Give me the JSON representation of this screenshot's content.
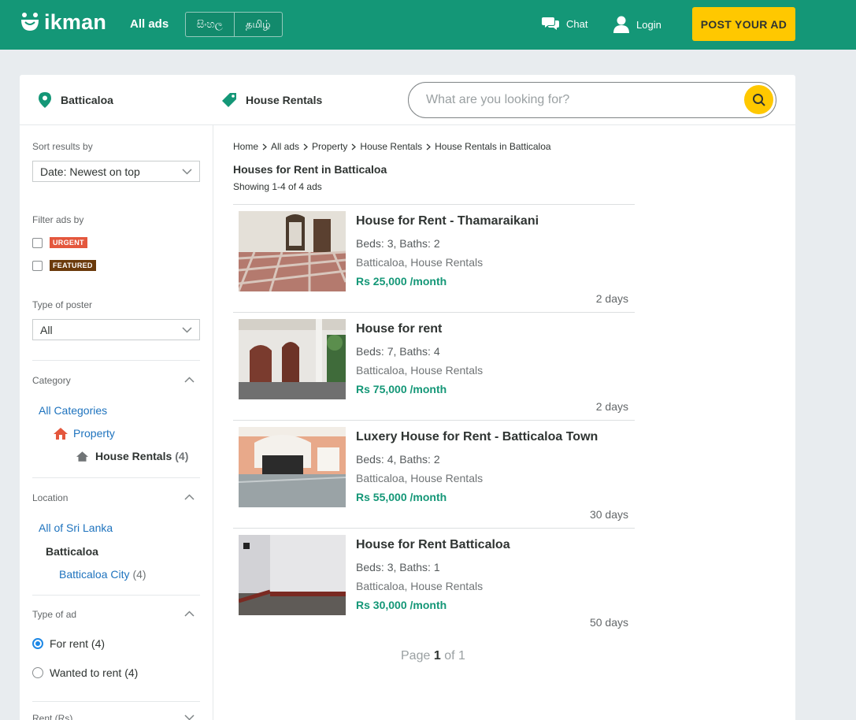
{
  "header": {
    "logo_text": "ikman",
    "all_ads": "All ads",
    "lang_sinhala": "සිංහල",
    "lang_tamil": "தமிழ்",
    "chat": "Chat",
    "login": "Login",
    "post_ad": "POST YOUR AD"
  },
  "filterbar": {
    "location": "Batticaloa",
    "category": "House Rentals",
    "search_placeholder": "What are you looking for?"
  },
  "sidebar": {
    "sort_label": "Sort results by",
    "sort_value": "Date: Newest on top",
    "filter_label": "Filter ads by",
    "urgent": "URGENT",
    "featured": "FEATURED",
    "poster_label": "Type of poster",
    "poster_value": "All",
    "category_label": "Category",
    "all_categories": "All Categories",
    "property": "Property",
    "house_rentals": "House Rentals",
    "house_rentals_count": "(4)",
    "location_label": "Location",
    "all_sri_lanka": "All of Sri Lanka",
    "batticaloa": "Batticaloa",
    "batticaloa_city": "Batticaloa City",
    "batticaloa_city_count": "(4)",
    "type_ad_label": "Type of ad",
    "for_rent": "For rent (4)",
    "wanted_to_rent": "Wanted to rent (4)",
    "rent_label": "Rent (Rs)"
  },
  "breadcrumbs": [
    "Home",
    "All ads",
    "Property",
    "House Rentals",
    "House Rentals in Batticaloa"
  ],
  "results": {
    "title": "Houses for Rent in Batticaloa",
    "showing": "Showing 1-4 of 4 ads"
  },
  "listings": [
    {
      "title": "House for Rent - Thamaraikani",
      "attrs": "Beds: 3, Baths: 2",
      "location": "Batticaloa, House Rentals",
      "price": "Rs 25,000 /month",
      "time": "2 days"
    },
    {
      "title": "House for rent",
      "attrs": "Beds: 7, Baths: 4",
      "location": "Batticaloa, House Rentals",
      "price": "Rs 75,000 /month",
      "time": "2 days"
    },
    {
      "title": "Luxery House for Rent - Batticaloa Town",
      "attrs": "Beds: 4, Baths: 2",
      "location": "Batticaloa, House Rentals",
      "price": "Rs 55,000 /month",
      "time": "30 days"
    },
    {
      "title": "House for Rent Batticaloa",
      "attrs": "Beds: 3, Baths: 1",
      "location": "Batticaloa, House Rentals",
      "price": "Rs 30,000 /month",
      "time": "50 days"
    }
  ],
  "pagination": {
    "page_word": "Page",
    "current": "1",
    "of_word": "of 1"
  },
  "colors": {
    "brand_green": "#149777",
    "accent_yellow": "#ffc800",
    "link_blue": "#1e73be",
    "urgent_badge": "#e4573d",
    "featured_badge": "#6b3a0b"
  }
}
